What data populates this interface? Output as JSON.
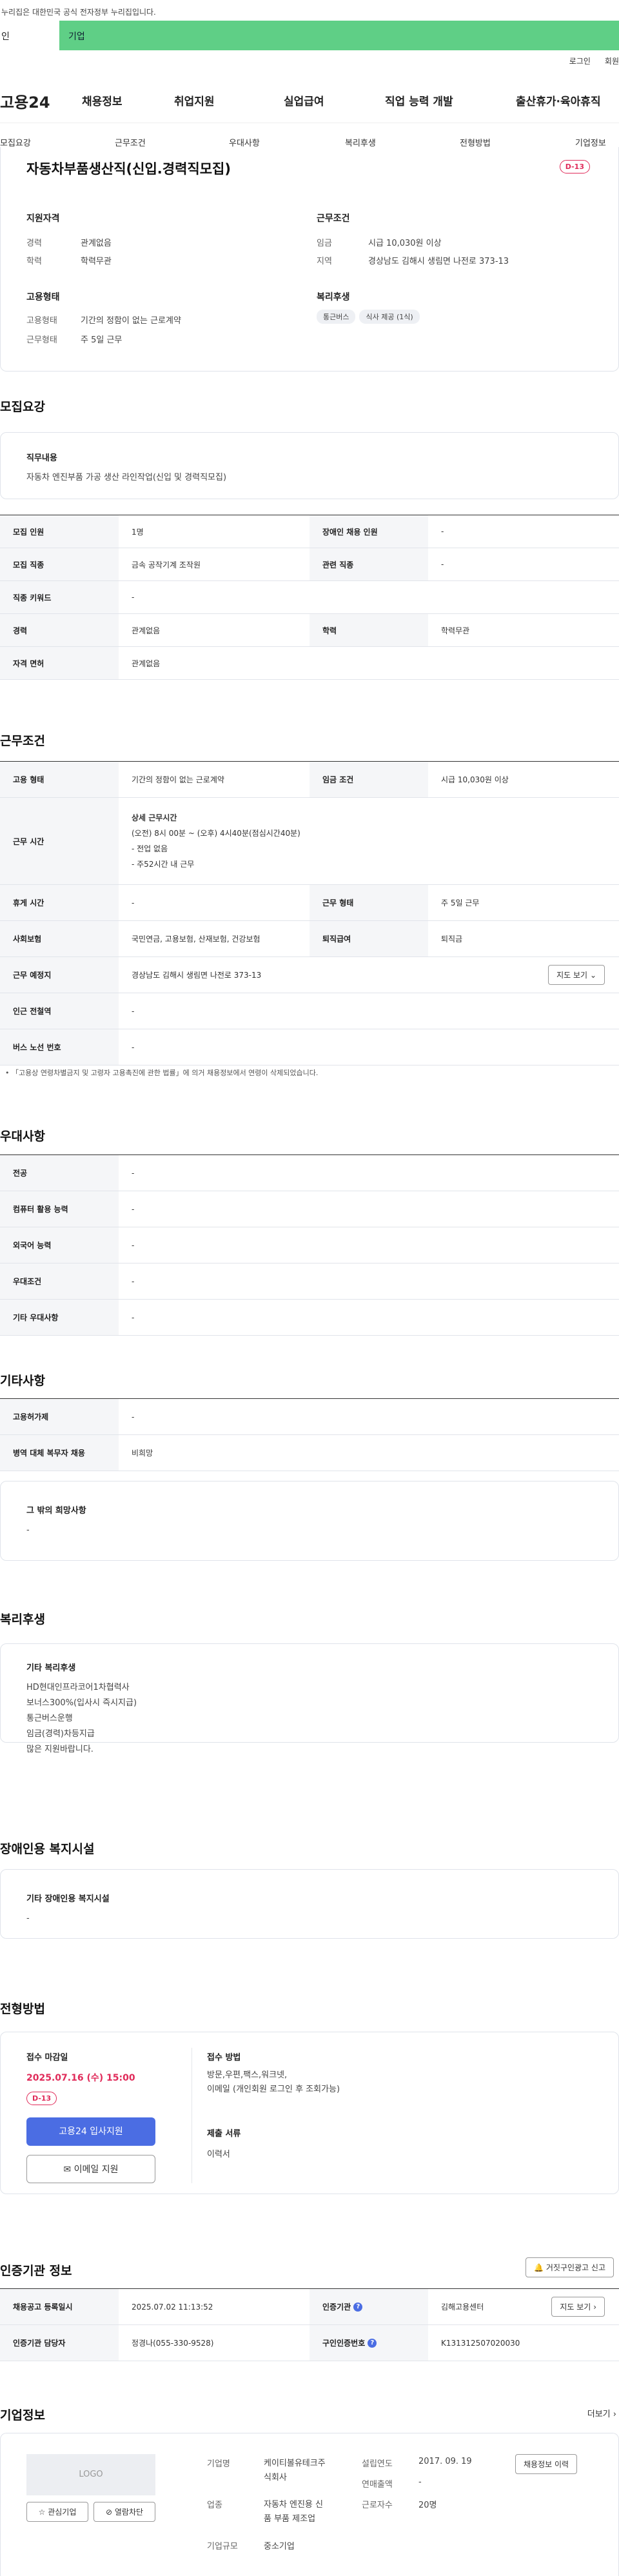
{
  "gov_banner": "이 누리집은 대한민국 공식 전자정부 누리집입니다.",
  "gov_banner_shown": "누리집은 대한민국 공식 전자정부 누리집입니다.",
  "infobar": {
    "left": "인",
    "right": "기업"
  },
  "util": {
    "login": "로그인",
    "join": "회원"
  },
  "logo": "고용24",
  "gnb": [
    "채용정보",
    "취업지원",
    "실업급여",
    "직업 능력 개발",
    "출산휴가·육아휴직"
  ],
  "tabs": [
    "모집요강",
    "근무조건",
    "우대사항",
    "복리후생",
    "전형방법",
    "기업정보"
  ],
  "job": {
    "title": "자동차부품생산직(신입.경력직모집)",
    "dday": "D-13"
  },
  "summary": {
    "qual_title": "지원자격",
    "career_k": "경력",
    "career_v": "관계없음",
    "edu_k": "학력",
    "edu_v": "학력무관",
    "cond_title": "근무조건",
    "wage_k": "임금",
    "wage_v": "시급 10,030원 이상",
    "region_k": "지역",
    "region_v": "경상남도 김해시 생림면 나전로 373-13",
    "emp_title": "고용형태",
    "emptype_k": "고용형태",
    "emptype_v": "기간의 정함이 없는 근로계약",
    "worktype_k": "근무형태",
    "worktype_v": "주 5일 근무",
    "welfare_title": "복리후생",
    "welfare_tags": [
      "통근버스",
      "식사 제공 (1식)"
    ]
  },
  "recruit": {
    "title": "모집요강",
    "duty_title": "직무내용",
    "duty_text": "자동차 엔진부품 가공 생산 라인작업(신입 및 경력직모집)",
    "rows": [
      {
        "k1": "모집 인원",
        "v1": "1명",
        "k2": "장애인 채용 인원",
        "v2": "-"
      },
      {
        "k1": "모집 직종",
        "v1": "금속 공작기계 조작원",
        "k2": "관련 직종",
        "v2": "-"
      },
      {
        "k1": "직종 키워드",
        "v1": "-"
      },
      {
        "k1": "경력",
        "v1": "관계없음",
        "k2": "학력",
        "v2": "학력무관"
      },
      {
        "k1": "자격 면허",
        "v1": "관계없음"
      }
    ]
  },
  "work": {
    "title": "근무조건",
    "r1": {
      "k1": "고용 형태",
      "v1": "기간의 정함이 없는 근로계약",
      "k2": "임금 조건",
      "v2": "시급 10,030원 이상"
    },
    "hours": {
      "k": "근무 시간",
      "head": "상세 근무시간",
      "l1": "(오전) 8시 00분 ~ (오후) 4시40분(점심시간40분)",
      "l2": "- 전업 없음",
      "l3": "- 주52시간 내 근무"
    },
    "r3": {
      "k1": "휴게 시간",
      "v1": "-",
      "k2": "근무 형태",
      "v2": "주 5일 근무"
    },
    "r4": {
      "k1": "사회보험",
      "v1": "국민연금, 고용보험, 산재보험, 건강보험",
      "k2": "퇴직급여",
      "v2": "퇴직금"
    },
    "r5": {
      "k": "근무 예정지",
      "v": "경상남도 김해시 생림면 나전로 373-13",
      "btn": "지도 보기"
    },
    "r6": {
      "k": "인근 전철역",
      "v": "-"
    },
    "r7": {
      "k": "버스 노선 번호",
      "v": "-"
    },
    "note": "「고용상 연령차별금지 및 고령자 고용촉진에 관한 법률」에 의거 채용정보에서 연령이 삭제되었습니다."
  },
  "pref": {
    "title": "우대사항",
    "rows": [
      {
        "k": "전공",
        "v": "-"
      },
      {
        "k": "컴퓨터 활용 능력",
        "v": "-"
      },
      {
        "k": "외국어 능력",
        "v": "-"
      },
      {
        "k": "우대조건",
        "v": "-"
      },
      {
        "k": "기타 우대사항",
        "v": "-"
      }
    ]
  },
  "etc": {
    "title": "기타사항",
    "rows": [
      {
        "k": "고용허가제",
        "v": "-"
      },
      {
        "k": "병역 대체 복무자 채용",
        "v": "비희망"
      }
    ],
    "box_title": "그 밖의 희망사항",
    "box_text": "-"
  },
  "welfare": {
    "title": "복리후생",
    "box_title": "기타 복리후생",
    "lines": [
      "HD현대인프라코어1차협력사",
      "보너스300%(입사시 즉시지급)",
      "통근버스운행",
      "임금(경력)차등지급",
      "많은 지원바랍니다."
    ]
  },
  "disabled": {
    "title": "장애인용 복지시설",
    "box_title": "기타 장애인용 복지시설",
    "box_text": "-"
  },
  "selection": {
    "title": "전형방법",
    "deadline_label": "접수 마감일",
    "deadline": "2025.07.16 (수) 15:00",
    "dday": "D-13",
    "apply_btn": "고용24 입사지원",
    "email_btn": "이메일 지원",
    "method_label": "접수 방법",
    "method_l1": "방문,우편,팩스,워크넷,",
    "method_l2": "이메일 (개인회원 로그인 후 조회가능)",
    "docs_label": "제출 서류",
    "docs": "이력서"
  },
  "agency": {
    "title": "인증기관 정보",
    "report_btn": "거짓구인광고 신고",
    "r1": {
      "k1": "채용공고 등록일시",
      "v1": "2025.07.02 11:13:52",
      "k2": "인증기관",
      "v2": "김해고용센터",
      "btn": "지도 보기"
    },
    "r2": {
      "k1": "인증기관 담당자",
      "v1": "정경나(055-330-9528)",
      "k2": "구인인증번호",
      "v2": "K131312507020030"
    }
  },
  "company": {
    "title": "기업정보",
    "more": "더보기",
    "logo": "LOGO",
    "fav_btn": "관심기업",
    "block_btn": "열람차단",
    "name_k": "기업명",
    "name_v1": "케이티볼유테크주",
    "name_v2": "식회사",
    "ind_k": "업종",
    "ind_v1": "자동차 엔진용 신",
    "ind_v2": "품 부품 제조업",
    "size_k": "기업규모",
    "size_v": "중소기업",
    "est_k": "설립연도",
    "est_v": "2017. 09. 19",
    "sales_k": "연매출액",
    "sales_v": "-",
    "emp_k": "근로자수",
    "emp_v": "20명",
    "resume_btn": "채용정보 이력"
  }
}
